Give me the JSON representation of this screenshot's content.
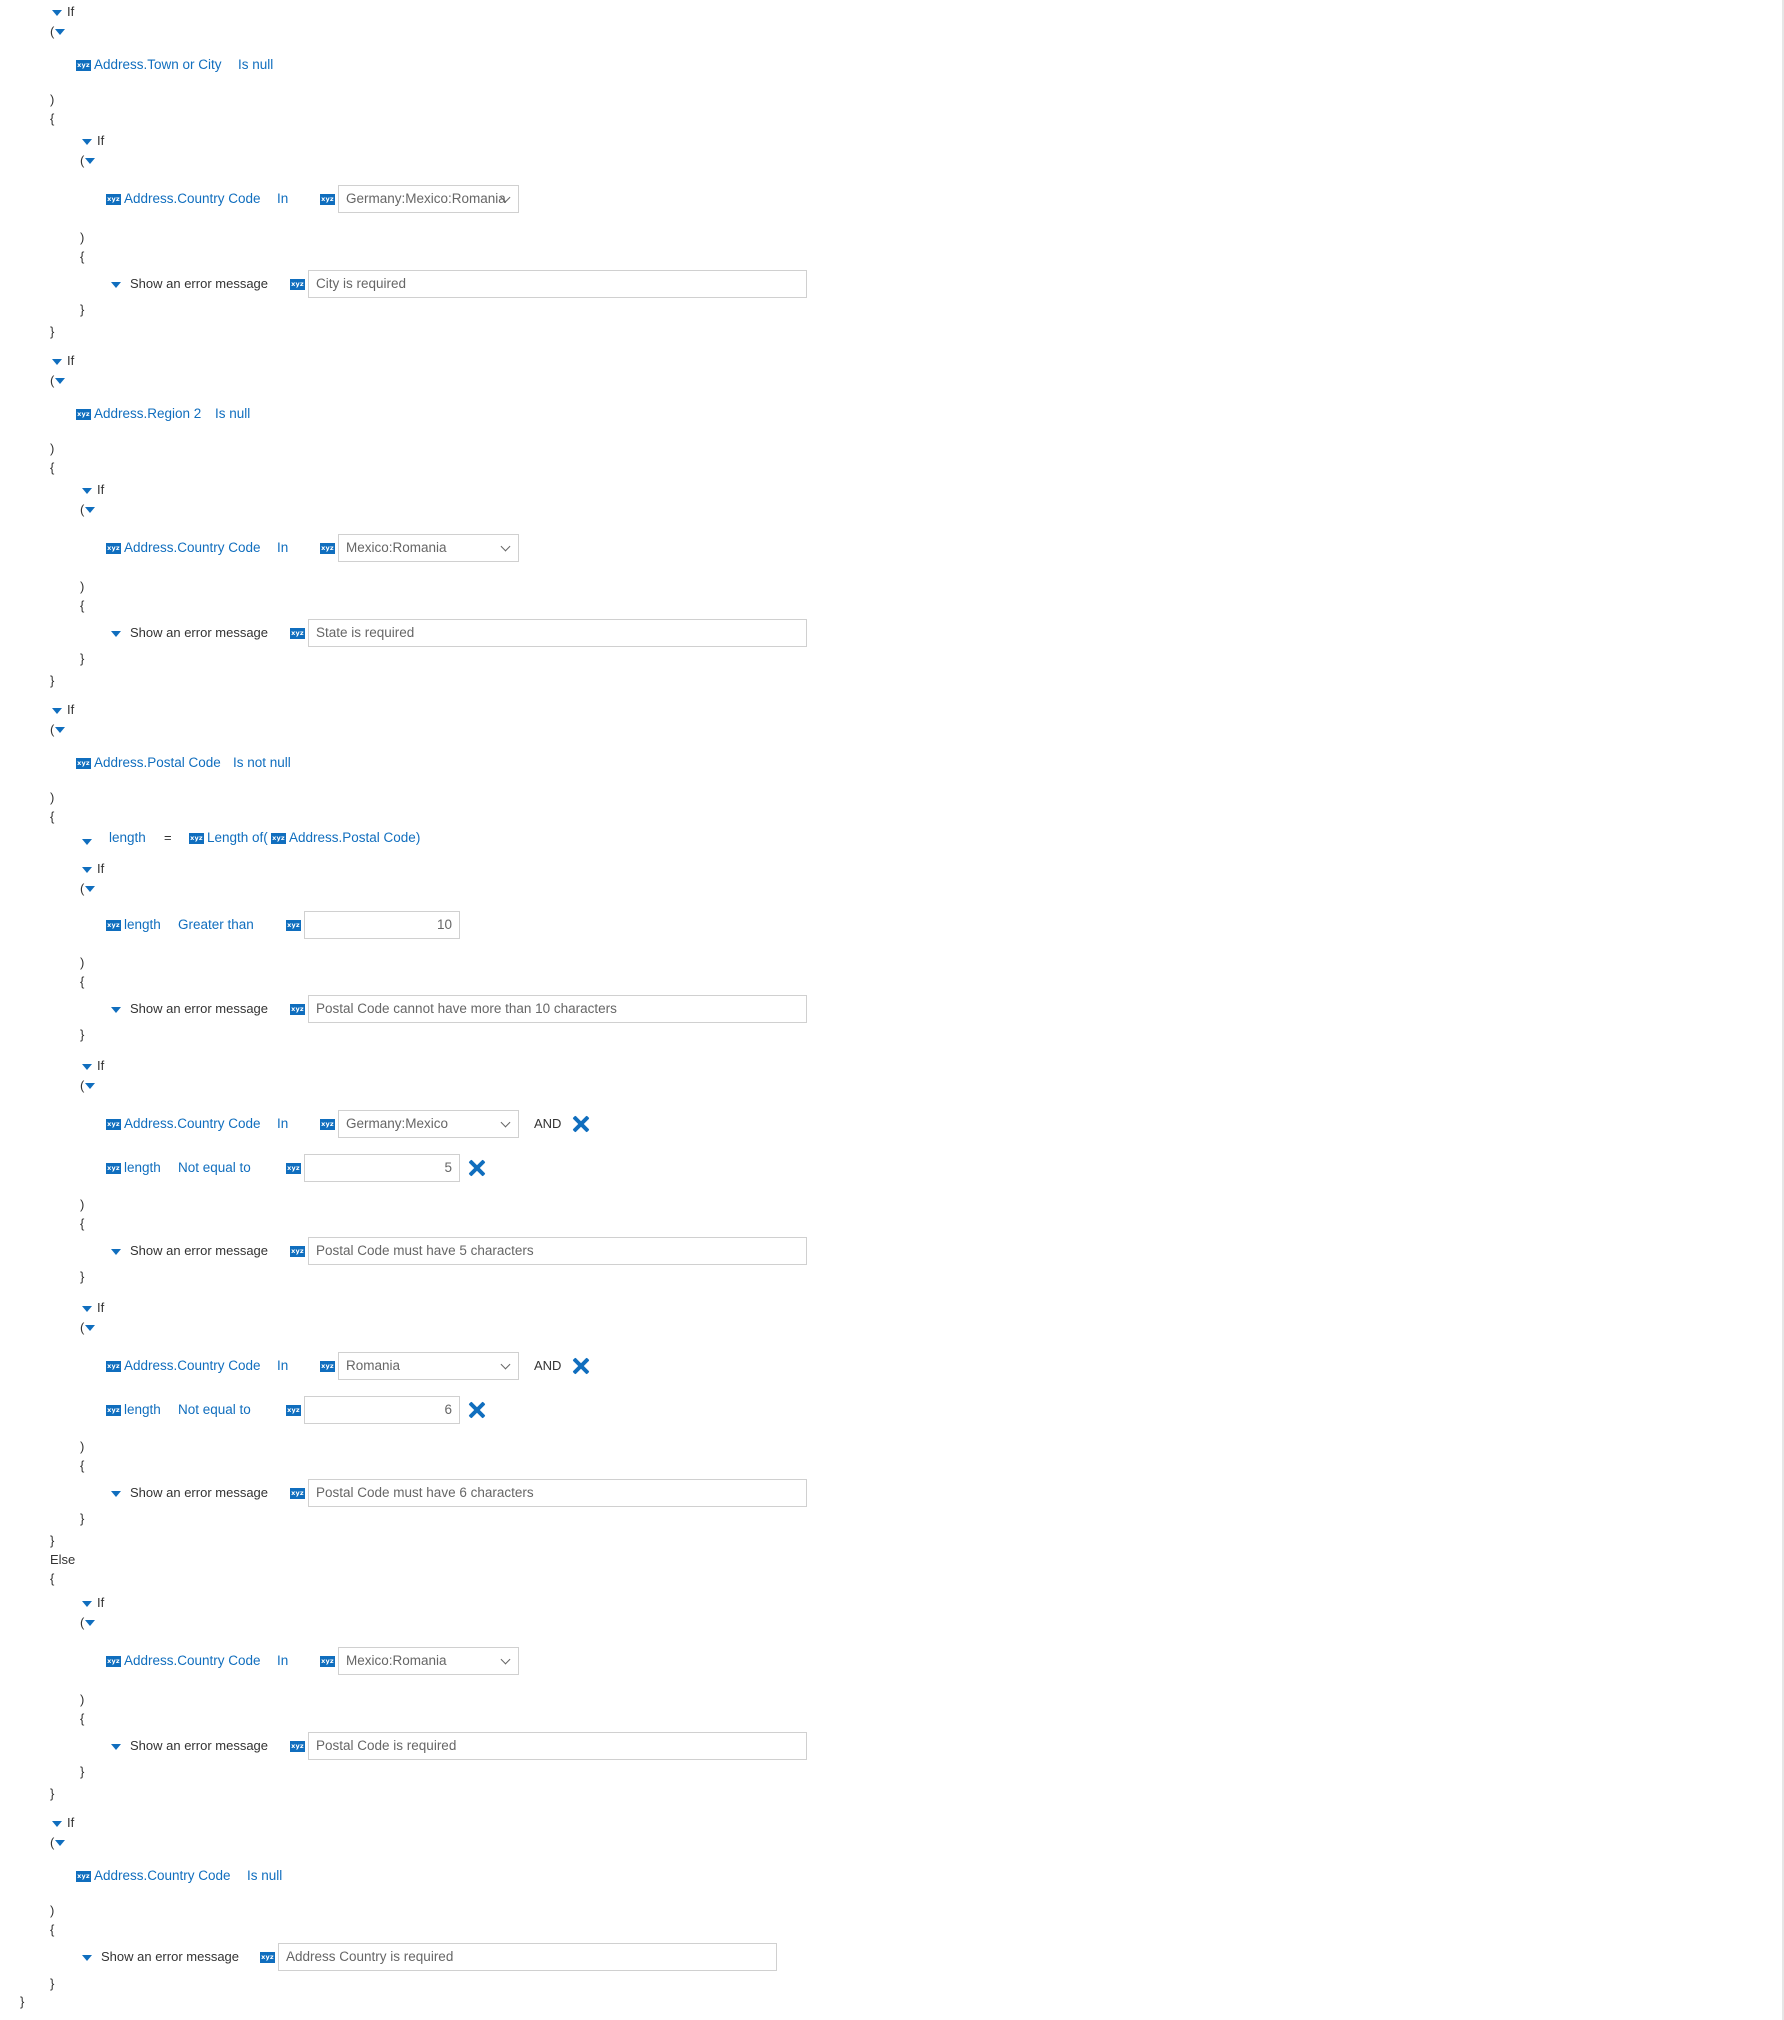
{
  "keywords": {
    "if": "If",
    "else": "Else",
    "open_paren": "(",
    "close_paren": ")",
    "open_brace": "{",
    "close_brace": "}",
    "and": "AND",
    "equals": "="
  },
  "icons": {
    "field_type": "xyz-icon",
    "expand": "caret-down-icon",
    "remove": "close-icon",
    "dropdown": "chevron-down-icon"
  },
  "colors": {
    "accent": "#106ebe",
    "text": "#333333",
    "input_border": "#d0d0d0"
  },
  "rule1": {
    "field": "Address.Town or City",
    "operator": "Is null",
    "inner_field": "Address.Country Code",
    "inner_operator": "In",
    "inner_value": "Germany:Mexico:Romania",
    "action": "Show an error message",
    "message": "City is required"
  },
  "rule2": {
    "field": "Address.Region 2",
    "operator": "Is null",
    "inner_field": "Address.Country Code",
    "inner_operator": "In",
    "inner_value": "Mexico:Romania",
    "action": "Show an error message",
    "message": "State is required"
  },
  "rule3": {
    "field": "Address.Postal Code",
    "operator": "Is not null",
    "assign": {
      "variable": "length",
      "function": "Length of(",
      "arg": "Address.Postal Code)"
    },
    "check1": {
      "field": "length",
      "operator": "Greater than",
      "value": "10",
      "action": "Show an error message",
      "message": "Postal Code cannot have more than 10 characters"
    },
    "check2": {
      "field": "Address.Country Code",
      "operator": "In",
      "value": "Germany:Mexico",
      "field2": "length",
      "operator2": "Not equal to",
      "value2": "5",
      "action": "Show an error message",
      "message": "Postal Code must have 5 characters"
    },
    "check3": {
      "field": "Address.Country Code",
      "operator": "In",
      "value": "Romania",
      "field2": "length",
      "operator2": "Not equal to",
      "value2": "6",
      "action": "Show an error message",
      "message": "Postal Code must have 6 characters"
    },
    "else_check": {
      "field": "Address.Country Code",
      "operator": "In",
      "value": "Mexico:Romania",
      "action": "Show an error message",
      "message": "Postal Code is required"
    }
  },
  "rule4": {
    "field": "Address.Country Code",
    "operator": "Is null",
    "action": "Show an error message",
    "message": "Address Country is required"
  }
}
